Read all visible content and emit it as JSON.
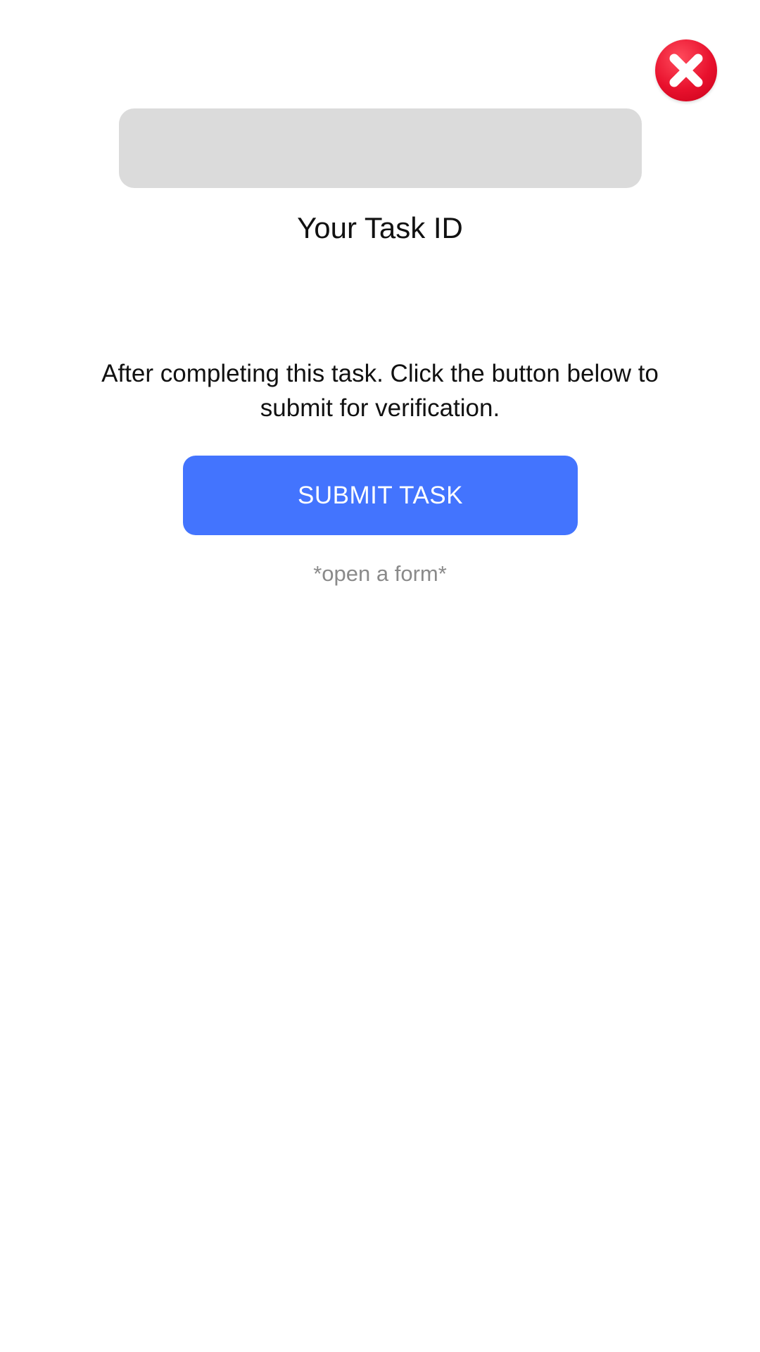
{
  "close": {
    "icon": "close-x-icon",
    "color": "#e8112d"
  },
  "task": {
    "id_value": "",
    "label": "Your Task ID"
  },
  "instructions": "After completing this task. Click the button below to submit for verification.",
  "submit_button": {
    "label": "SUBMIT TASK",
    "color": "#4374fe"
  },
  "hint": "*open a form*"
}
